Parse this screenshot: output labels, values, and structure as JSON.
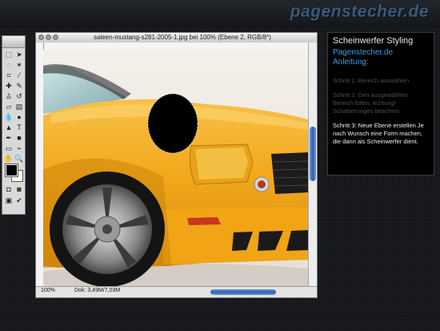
{
  "header": {
    "brand": "pagenstecher.de"
  },
  "document": {
    "title": "saleen-mustang-s281-2005-1.jpg bei 100% (Ebene 2, RGB/8*)",
    "zoom": "100%",
    "doc_info": "Dok: 3,49M/7,03M"
  },
  "panel": {
    "title": "Scheinwerfer Styling",
    "site": "Pagenstecher.de",
    "subtitle": "Anleitung:",
    "steps": [
      {
        "text": "Schritt 1: Bereich auswählen"
      },
      {
        "text": "Schritt 2: Den ausgewählten Bereich füllen. Achtung! Schattierungen beachten"
      },
      {
        "text": "Schritt 3: Neue Ebene erstellen Je nach Wunsch eine Form machen, die dann als Scheinwerfer dient."
      }
    ]
  },
  "colors": {
    "accent": "#3aa0e8",
    "car": "#f2a91a",
    "background": "#15171a"
  }
}
